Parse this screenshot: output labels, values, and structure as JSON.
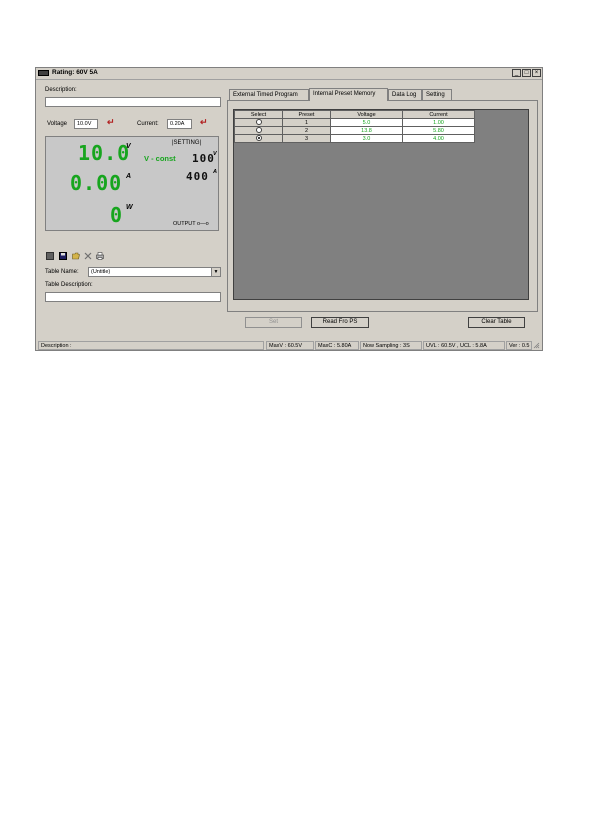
{
  "window": {
    "title": "Rating: 60V 5A",
    "min_glyph": "_",
    "max_glyph": "□",
    "close_glyph": "×"
  },
  "left": {
    "description_label": "Description:",
    "description_value": "",
    "voltage_label": "Voltage",
    "voltage_value": "10.0V",
    "current_label": "Current:",
    "current_value": "0.20A",
    "enter_glyph": "↵"
  },
  "display": {
    "voltage_reading": "10.0",
    "voltage_unit": "V",
    "current_reading": "0.00",
    "current_unit": "A",
    "power_reading": "0",
    "power_unit": "W",
    "setting_label": "|SETTING|",
    "mode_text": "V - const",
    "set_voltage": "100",
    "set_voltage_unit": "V",
    "set_current": "400",
    "set_current_unit": "A",
    "output_label": "OUTPUT o—o"
  },
  "toolbar": {
    "icons": [
      "new-icon",
      "save-icon",
      "open-folder-icon",
      "delete-icon",
      "print-icon"
    ]
  },
  "table_panel": {
    "table_name_label": "Table Name:",
    "table_name_value": "(Untitle)",
    "table_description_label": "Table Description:",
    "table_description_value": ""
  },
  "tabs": [
    {
      "label": "External Timed Program",
      "active": false
    },
    {
      "label": "Internal Preset Memory",
      "active": true
    },
    {
      "label": "Data Log",
      "active": false
    },
    {
      "label": "Setting",
      "active": false
    }
  ],
  "preset_table": {
    "columns": [
      "Select",
      "Preset",
      "Voltage",
      "Current"
    ],
    "rows": [
      {
        "selected": false,
        "preset": "1",
        "voltage": "5.0",
        "current": "1.00"
      },
      {
        "selected": false,
        "preset": "2",
        "voltage": "13.8",
        "current": "5.80"
      },
      {
        "selected": true,
        "preset": "3",
        "voltage": "3.0",
        "current": "4.00"
      }
    ]
  },
  "buttons": {
    "set": "Set",
    "read": "Read Fro PS",
    "clear": "Clear Table"
  },
  "status": {
    "description": "Description :",
    "maxv": "MaxV : 60.5V",
    "maxc": "MaxC : 5.80A",
    "sampling": "Now Sampling : 3S",
    "limits": "UVL : 60.5V , UCL : 5.8A",
    "ver": "Ver : 0.5"
  }
}
